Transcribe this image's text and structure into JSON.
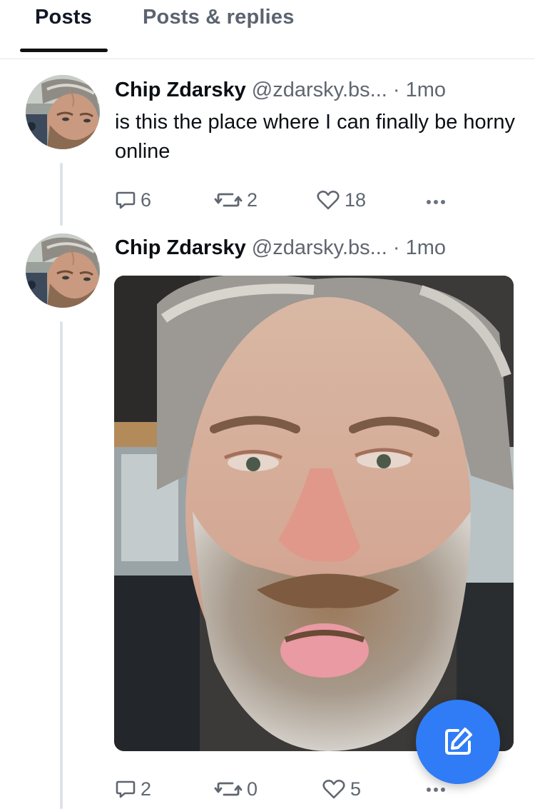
{
  "tabs": {
    "posts": "Posts",
    "replies": "Posts & replies"
  },
  "posts": [
    {
      "author_name": "Chip Zdarsky",
      "author_handle": "@zdarsky.bs...",
      "separator": "·",
      "time": "1mo",
      "text": "is this the place where I can finally be horny online",
      "replies": "6",
      "reposts": "2",
      "likes": "18"
    },
    {
      "author_name": "Chip Zdarsky",
      "author_handle": "@zdarsky.bs...",
      "separator": "·",
      "time": "1mo",
      "replies": "2",
      "reposts": "0",
      "likes": "5"
    }
  ],
  "colors": {
    "accent": "#2f7cf6",
    "muted_text": "#5f6670",
    "thread_line": "#dfe3e8"
  },
  "icons": {
    "reply": "speech-bubble-icon",
    "repost": "repost-arrows-icon",
    "like": "heart-icon",
    "more": "ellipsis-icon",
    "compose": "compose-pencil-icon"
  }
}
